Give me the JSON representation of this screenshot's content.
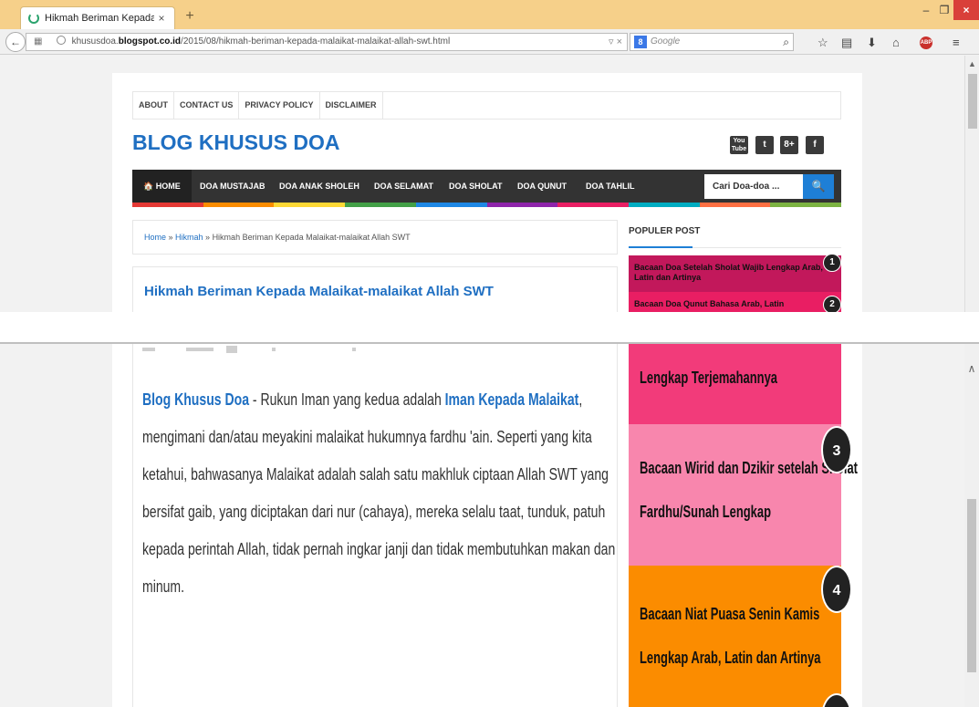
{
  "browser": {
    "tab_title": "Hikmah Beriman Kepada ...",
    "tab_close": "×",
    "new_tab": "+",
    "url_domain": "khususdoa.",
    "url_bold": "blogspot.co.id",
    "url_path": "/2015/08/hikmah-beriman-kepada-malaikat-malaikat-allah-swt.html",
    "url_controls": "▿ ×",
    "search_placeholder": "Google",
    "search_engine_label": "8",
    "window_min": "–",
    "window_max": "❐",
    "window_close": "×",
    "abp_label": "ABP"
  },
  "site": {
    "top_menu": [
      "ABOUT",
      "CONTACT US",
      "PRIVACY POLICY",
      "DISCLAIMER"
    ],
    "blog_title": "BLOG KHUSUS DOA",
    "social": [
      "You Tube",
      "t",
      "8+",
      "f"
    ],
    "nav_home": "🏠 HOME",
    "nav_items": [
      "DOA MUSTAJAB",
      "DOA ANAK SHOLEH",
      "DOA SELAMAT",
      "DOA SHOLAT",
      "DOA QUNUT",
      "DOA TAHLIL"
    ],
    "search_value": "Cari Doa-doa ...",
    "search_btn": "🔍",
    "rainbow": [
      "#e53935",
      "#fb8c00",
      "#fdd835",
      "#43a047",
      "#1e88e5",
      "#8e24aa",
      "#e91e63",
      "#00acc1",
      "#ff7043",
      "#7cb342"
    ]
  },
  "breadcrumb": {
    "home": "Home",
    "sep1": " » ",
    "category": "Hikmah",
    "sep2": " » ",
    "current": "Hikmah Beriman Kepada Malaikat-malaikat Allah SWT"
  },
  "post": {
    "title": "Hikmah Beriman Kepada Malaikat-malaikat Allah SWT",
    "lead_link": "Blog Khusus Doa",
    "text1": " - Rukun Iman yang kedua adalah ",
    "inner_link": "Iman Kepada Malaikat",
    "text2": ", mengimani dan/atau meyakini malaikat hukumnya fardhu 'ain. Seperti yang kita ketahui, bahwasanya Malaikat adalah salah satu makhluk ciptaan Allah SWT yang bersifat gaib, yang diciptakan dari nur (cahaya), mereka selalu taat, tunduk, patuh kepada perintah Allah, tidak pernah ingkar janji dan tidak membutuhkan makan dan minum."
  },
  "popular": {
    "heading": "POPULER POST",
    "top_items": [
      {
        "num": "1",
        "title": "Bacaan Doa Setelah Sholat Wajib Lengkap Arab, Latin dan Artinya",
        "color": "#c2185b"
      },
      {
        "num": "2",
        "title": "Bacaan Doa Qunut Bahasa Arab, Latin",
        "color": "#e91e63"
      }
    ],
    "bottom_items": [
      {
        "num": "",
        "line1": "Lengkap Terjemahannya",
        "line2": "",
        "color": "#f23b7a"
      },
      {
        "num": "3",
        "line1": "Bacaan Wirid dan Dzikir setelah Sholat",
        "line2": "Fardhu/Sunah Lengkap",
        "color": "#f886ad"
      },
      {
        "num": "4",
        "line1": "Bacaan Niat Puasa Senin Kamis",
        "line2": "Lengkap Arab, Latin dan Artinya",
        "color": "#fb8c00"
      }
    ]
  }
}
